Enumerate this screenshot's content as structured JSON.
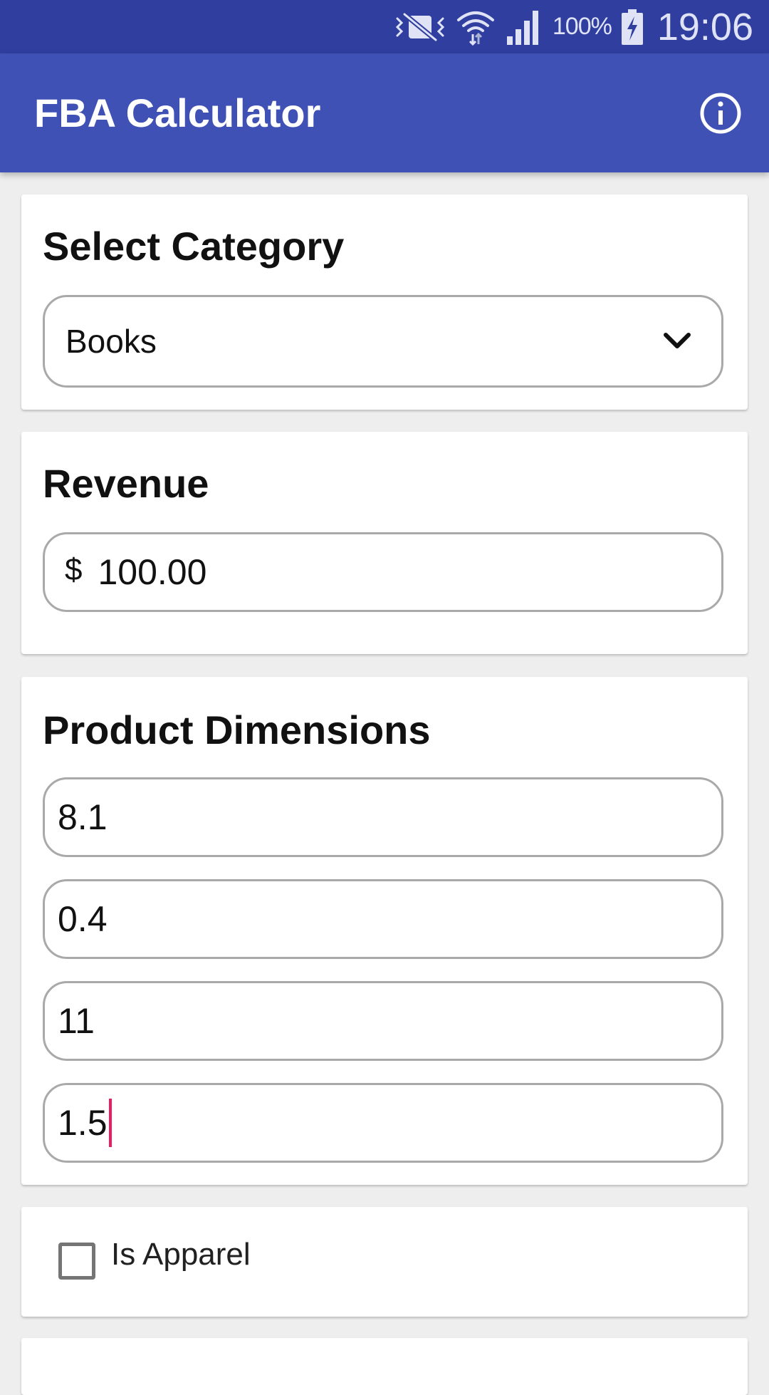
{
  "status_bar": {
    "battery_percent": "100%",
    "time": "19:06",
    "icons": [
      "vibrate-mute-icon",
      "wifi-icon",
      "signal-icon",
      "battery-charging-icon"
    ]
  },
  "app_bar": {
    "title": "FBA Calculator",
    "info_icon": "info-icon"
  },
  "category_card": {
    "title": "Select Category",
    "selected": "Books"
  },
  "revenue_card": {
    "title": "Revenue",
    "currency_symbol": "$",
    "value": "100.00"
  },
  "dimensions_card": {
    "title": "Product Dimensions",
    "fields": [
      "8.1",
      "0.4",
      "11",
      "1.5"
    ]
  },
  "apparel_card": {
    "checkbox_label": "Is Apparel",
    "checked": false
  },
  "colors": {
    "status_bar": "#303f9f",
    "app_bar": "#3f51b5",
    "caret": "#e91e63"
  }
}
